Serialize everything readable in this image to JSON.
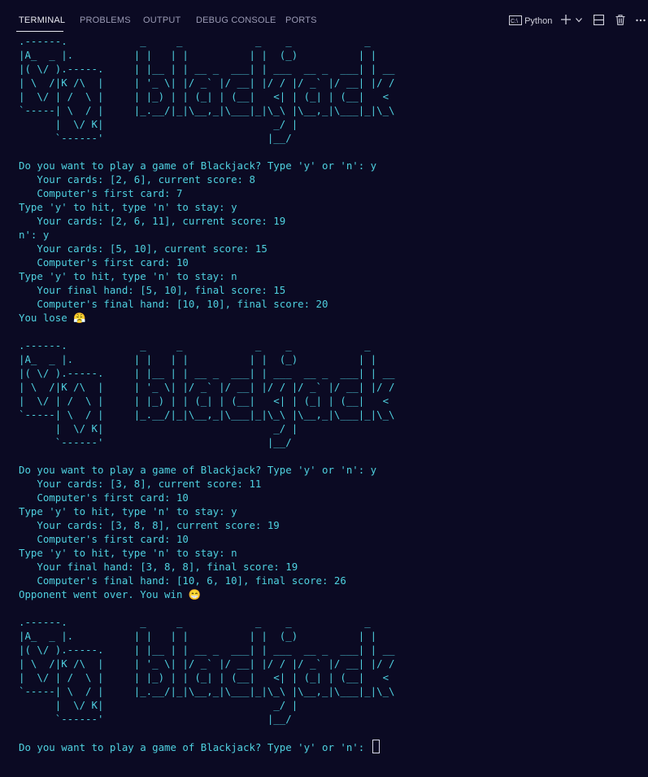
{
  "tabs": [
    {
      "label": "TERMINAL"
    },
    {
      "label": "PROBLEMS"
    },
    {
      "label": "OUTPUT"
    },
    {
      "label": "DEBUG CONSOLE"
    },
    {
      "label": "PORTS"
    }
  ],
  "toolbar": {
    "shell_label": "Python",
    "icons": [
      "terminal-shell-icon",
      "plus-icon",
      "chevron-down-icon",
      "split-icon",
      "trash-icon",
      "more-icon"
    ]
  },
  "colors": {
    "background": "#0b0a23",
    "terminal_text": "#4fd1e0",
    "tab_active": "#e8e8f0",
    "tab_inactive": "#9a9ab4"
  },
  "logo_art": [
    ".------.            _     _            _    _            _",
    "|A_  _ |.          | |   | |          | |  (_)          | |",
    "|( \\/ ).-----.     | |__ | | __ _  ___| | ___  __ _  ___| | __",
    "| \\  /|K /\\  |     | '_ \\| |/ _` |/ __| |/ / |/ _` |/ __| |/ /",
    "|  \\/ | /  \\ |     | |_) | | (_| | (__|   <| | (_| | (__|   <",
    "`-----| \\  / |     |_.__/|_|\\__,_|\\___|_|\\_\\ |\\__,_|\\___|_|\\_\\",
    "      |  \\/ K|                            _/ |",
    "      `------'                           |__/"
  ],
  "output": {
    "round1": [
      "Do you want to play a game of Blackjack? Type 'y' or 'n': y",
      "   Your cards: [2, 6], current score: 8",
      "   Computer's first card: 7",
      "Type 'y' to hit, type 'n' to stay: y",
      "   Your cards: [2, 6, 11], current score: 19",
      "n': y",
      "   Your cards: [5, 10], current score: 15",
      "   Computer's first card: 10",
      "Type 'y' to hit, type 'n' to stay: n",
      "   Your final hand: [5, 10], final score: 15",
      "   Computer's final hand: [10, 10], final score: 20",
      "You lose 😤"
    ],
    "round2": [
      "Do you want to play a game of Blackjack? Type 'y' or 'n': y",
      "   Your cards: [3, 8], current score: 11",
      "   Computer's first card: 10",
      "Type 'y' to hit, type 'n' to stay: y",
      "   Your cards: [3, 8, 8], current score: 19",
      "   Computer's first card: 10",
      "Type 'y' to hit, type 'n' to stay: n",
      "   Your final hand: [3, 8, 8], final score: 19",
      "   Computer's final hand: [10, 6, 10], final score: 26",
      "Opponent went over. You win 😁"
    ],
    "prompt": "Do you want to play a game of Blackjack? Type 'y' or 'n': "
  }
}
